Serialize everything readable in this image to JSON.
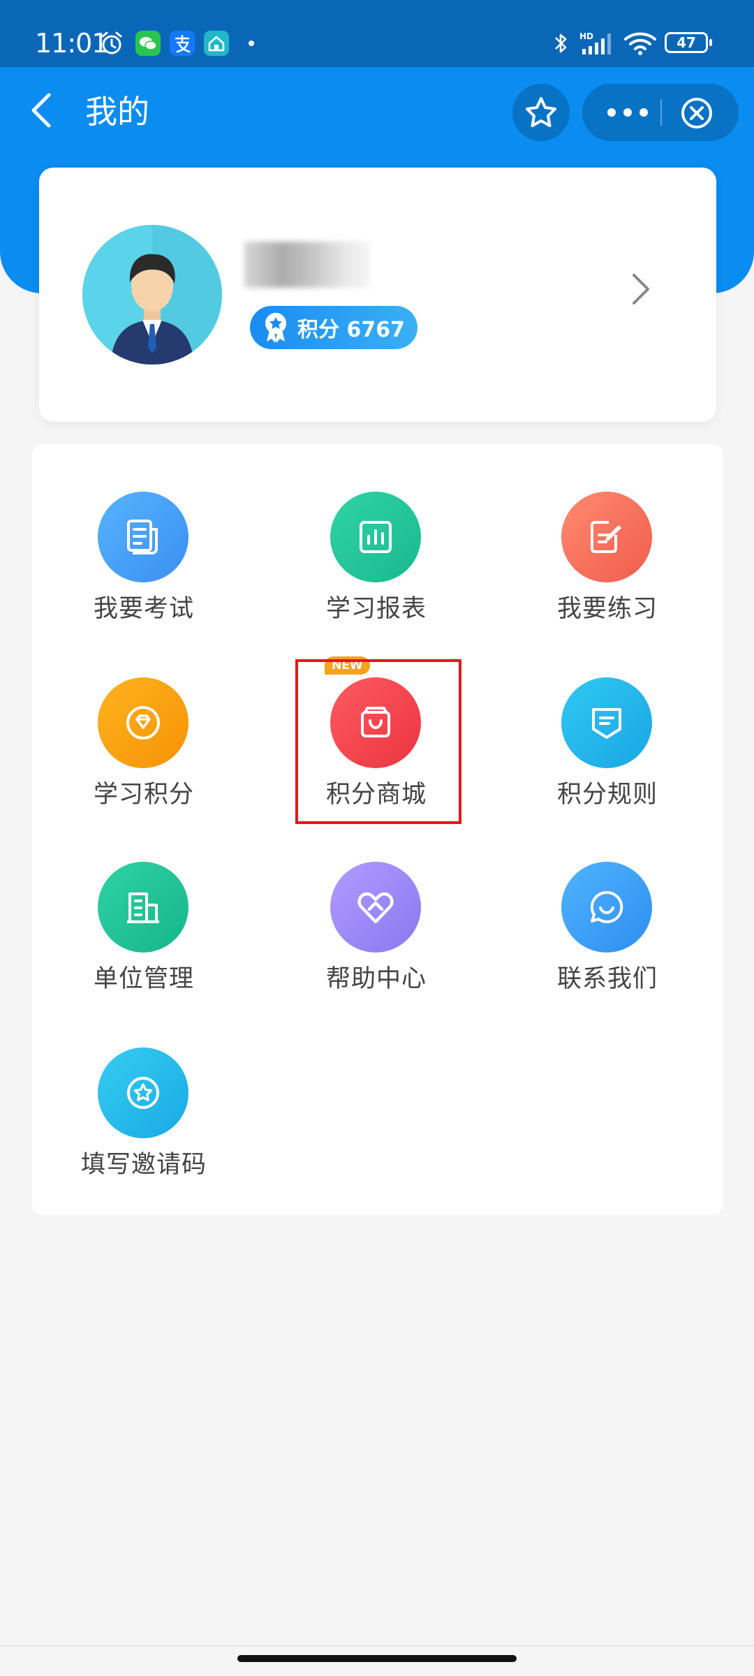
{
  "status_bar": {
    "time": "11:01",
    "battery": "47",
    "network_label": "HD"
  },
  "nav": {
    "title": "我的"
  },
  "profile": {
    "points_label": "积分 6767"
  },
  "menu": {
    "items": [
      {
        "label": "我要考试",
        "icon": "exam-doc-icon",
        "color": "#3a9cf2"
      },
      {
        "label": "学习报表",
        "icon": "report-chart-icon",
        "color": "#22c39a"
      },
      {
        "label": "我要练习",
        "icon": "practice-edit-icon",
        "color": "#f76f5d"
      },
      {
        "label": "学习积分",
        "icon": "points-diamond-icon",
        "color": "#f8a30f"
      },
      {
        "label": "积分商城",
        "icon": "shopping-bag-icon",
        "color": "#f0404a",
        "tag": "NEW"
      },
      {
        "label": "积分规则",
        "icon": "rules-badge-icon",
        "color": "#1fb6ec"
      },
      {
        "label": "单位管理",
        "icon": "building-icon",
        "color": "#1ec39a"
      },
      {
        "label": "帮助中心",
        "icon": "heart-help-icon",
        "color": "#9d8cf5"
      },
      {
        "label": "联系我们",
        "icon": "chat-smile-icon",
        "color": "#2e9df4"
      },
      {
        "label": "填写邀请码",
        "icon": "star-invite-icon",
        "color": "#25bde9"
      }
    ]
  },
  "colors": {
    "header_blue": "#0a8cf0",
    "status_blue": "#0a67b8",
    "highlight_red": "#e8141c"
  }
}
